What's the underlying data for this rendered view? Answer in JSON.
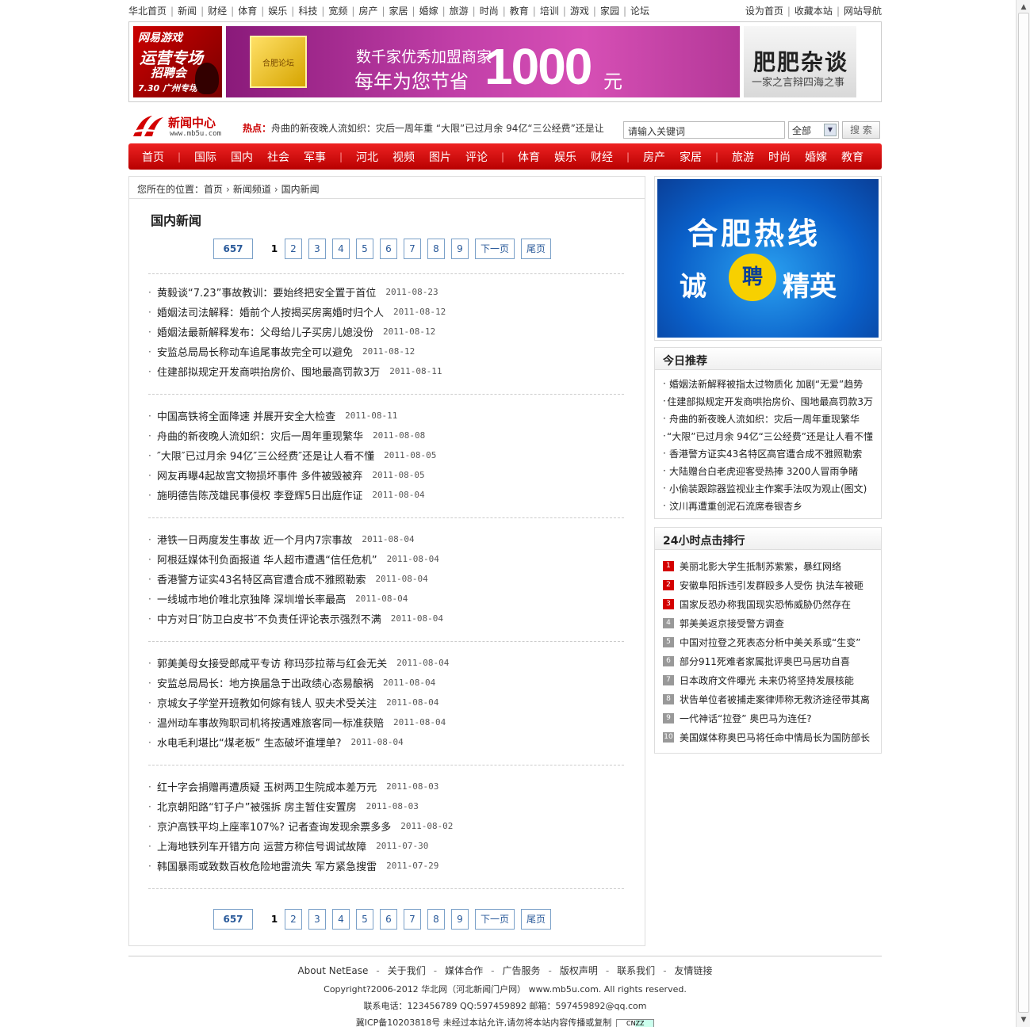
{
  "topnav": {
    "left": [
      "华北首页",
      "新闻",
      "财经",
      "体育",
      "娱乐",
      "科技",
      "宽频",
      "房产",
      "家居",
      "婚嫁",
      "旅游",
      "时尚",
      "教育",
      "培训",
      "游戏",
      "家园",
      "论坛"
    ],
    "right": [
      "设为首页",
      "收藏本站",
      "网站导航"
    ]
  },
  "banners": {
    "b1": {
      "t1": "网易游戏",
      "t2": "运营专场",
      "t3": "招聘会",
      "t4": "7.30 广州专场"
    },
    "b2": {
      "cert": "合肥论坛",
      "l1": "数千家优秀加盟商家",
      "l2": "每年为您节省",
      "big": "1000",
      "unit": "元"
    },
    "b3": {
      "b1": "肥肥杂谈",
      "b2": "一家之言辩四海之事"
    }
  },
  "logo": {
    "name": "新闻中心",
    "url": "www.mb5u.com"
  },
  "hot": {
    "label": "热点：",
    "text": "舟曲的新夜晚人流如织：灾后一周年重 “大限”已过月余 94亿“三公经费”还是让"
  },
  "search": {
    "placeholder": "请输入关键词",
    "scope": "全部",
    "button": "搜 索"
  },
  "rednav": [
    "首页",
    "|",
    "国际",
    "国内",
    "社会",
    "军事",
    "|",
    "河北",
    "视频",
    "图片",
    "评论",
    "|",
    "体育",
    "娱乐",
    "财经",
    "|",
    "房产",
    "家居",
    "|",
    "旅游",
    "时尚",
    "婚嫁",
    "教育"
  ],
  "crumb": {
    "prefix": "您所在的位置：",
    "items": [
      "首页",
      "新闻频道",
      "国内新闻"
    ]
  },
  "page_title": "国内新闻",
  "pager": {
    "total": "657",
    "current": "1",
    "pages": [
      "2",
      "3",
      "4",
      "5",
      "6",
      "7",
      "8",
      "9"
    ],
    "next": "下一页",
    "last": "尾页"
  },
  "news_groups": [
    [
      {
        "title": "黄毅谈“7.23”事故教训：要始终把安全置于首位",
        "date": "2011-08-23"
      },
      {
        "title": "婚姻法司法解释：婚前个人按揭买房离婚时归个人",
        "date": "2011-08-12"
      },
      {
        "title": "婚姻法最新解释发布：父母给儿子买房儿媳没份",
        "date": "2011-08-12"
      },
      {
        "title": "安监总局局长称动车追尾事故完全可以避免",
        "date": "2011-08-12"
      },
      {
        "title": "住建部拟规定开发商哄抬房价、囤地最高罚款3万",
        "date": "2011-08-11"
      }
    ],
    [
      {
        "title": "中国高铁将全面降速 并展开安全大检查",
        "date": "2011-08-11"
      },
      {
        "title": "舟曲的新夜晚人流如织：灾后一周年重现繁华",
        "date": "2011-08-08"
      },
      {
        "title": "″大限″已过月余 94亿″三公经费″还是让人看不懂",
        "date": "2011-08-05"
      },
      {
        "title": "网友再曝4起故宫文物损坏事件 多件被毁被弃",
        "date": "2011-08-05"
      },
      {
        "title": "施明德告陈茂雄民事侵权 李登辉5日出庭作证",
        "date": "2011-08-04"
      }
    ],
    [
      {
        "title": "港铁一日两度发生事故 近一个月内7宗事故",
        "date": "2011-08-04"
      },
      {
        "title": "阿根廷媒体刊负面报道 华人超市遭遇“信任危机”",
        "date": "2011-08-04"
      },
      {
        "title": "香港警方证实43名特区高官遭合成不雅照勒索",
        "date": "2011-08-04"
      },
      {
        "title": "一线城市地价唯北京独降 深圳增长率最高",
        "date": "2011-08-04"
      },
      {
        "title": "中方对日″防卫白皮书″不负责任评论表示强烈不满",
        "date": "2011-08-04"
      }
    ],
    [
      {
        "title": "郭美美母女接受郎咸平专访 称玛莎拉蒂与红会无关",
        "date": "2011-08-04"
      },
      {
        "title": "安监总局局长：地方换届急于出政绩心态易酿祸",
        "date": "2011-08-04"
      },
      {
        "title": "京城女子学堂开班教如何嫁有钱人 驭夫术受关注",
        "date": "2011-08-04"
      },
      {
        "title": "温州动车事故殉职司机将按遇难旅客同一标准获赔",
        "date": "2011-08-04"
      },
      {
        "title": "水电毛利堪比“煤老板” 生态破坏谁埋单?",
        "date": "2011-08-04"
      }
    ],
    [
      {
        "title": "红十字会捐赠再遭质疑 玉树两卫生院成本差万元",
        "date": "2011-08-03"
      },
      {
        "title": "北京朝阳路“钉子户”被强拆 房主暂住安置房",
        "date": "2011-08-03"
      },
      {
        "title": "京沪高铁平均上座率107%? 记者查询发现余票多多",
        "date": "2011-08-02"
      },
      {
        "title": "上海地铁列车开错方向 运营方称信号调试故障",
        "date": "2011-07-30"
      },
      {
        "title": "韩国暴雨或致数百枚危险地雷流失 军方紧急搜雷",
        "date": "2011-07-29"
      }
    ]
  ],
  "ad_right": {
    "a1": "合肥热线",
    "a2": "诚",
    "a3": "聘",
    "a4": "精英"
  },
  "recommend": {
    "title": "今日推荐",
    "items": [
      "婚姻法新解释被指太过物质化 加剧“无爱”趋势",
      "住建部拟规定开发商哄抬房价、囤地最高罚款3万",
      "舟曲的新夜晚人流如织：灾后一周年重现繁华",
      "“大限”已过月余 94亿“三公经费”还是让人看不懂",
      "香港警方证实43名特区高官遭合成不雅照勒索",
      "大陆赠台白老虎迎客受热捧 3200人冒雨争睹",
      "小偷装跟踪器监视业主作案手法叹为观止(图文)",
      "汶川再遭重创泥石流席卷银杏乡"
    ]
  },
  "ranking": {
    "title": "24小时点击排行",
    "items": [
      {
        "n": "1",
        "t": "美丽北影大学生抵制苏紫紫，暴红网络"
      },
      {
        "n": "2",
        "t": "安徽阜阳拆违引发群殴多人受伤 执法车被砸"
      },
      {
        "n": "3",
        "t": "国家反恐办称我国现实恐怖威胁仍然存在"
      },
      {
        "n": "4",
        "t": "郭美美返京接受警方调查"
      },
      {
        "n": "5",
        "t": "中国对拉登之死表态分析中美关系或“生变”"
      },
      {
        "n": "6",
        "t": "部分911死难者家属批评奥巴马居功自喜"
      },
      {
        "n": "7",
        "t": "日本政府文件曝光 未来仍将坚持发展核能"
      },
      {
        "n": "8",
        "t": "状告单位者被捕走案律师称无救济途径带其离"
      },
      {
        "n": "9",
        "t": "一代神话“拉登” 奥巴马为连任?"
      },
      {
        "n": "10",
        "t": "美国媒体称奥巴马将任命中情局长为国防部长"
      }
    ]
  },
  "footer": {
    "links": [
      "About NetEase",
      "关于我们",
      "媒体合作",
      "广告服务",
      "版权声明",
      "联系我们",
      "友情链接"
    ],
    "copyright": "Copyright?2006-2012 华北网（河北新闻门户网） www.mb5u.com. All rights reserved.",
    "contact": "联系电话：123456789 QQ:597459892 邮箱：597459892@qq.com",
    "icp": "冀ICP备10203818号 未经过本站允许,请勿将本站内容传播或复制",
    "cnzz": "CNZZ"
  },
  "colors": {
    "accent_red": "#c00000",
    "link_blue": "#2a5a9a"
  }
}
